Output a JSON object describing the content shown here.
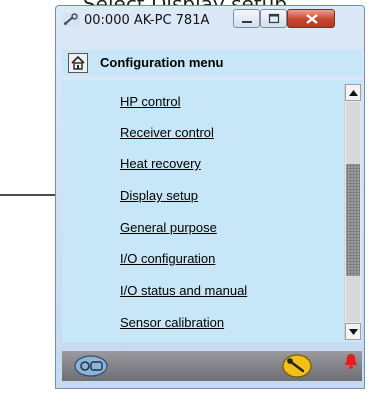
{
  "caption": "Select Display setup",
  "window": {
    "title": "00:000 AK-PC 781A"
  },
  "menu": {
    "title": "Configuration menu",
    "items": [
      {
        "label": "HP control"
      },
      {
        "label": "Receiver control"
      },
      {
        "label": "Heat recovery"
      },
      {
        "label": "Display setup"
      },
      {
        "label": "General purpose"
      },
      {
        "label": "I/O configuration"
      },
      {
        "label": "I/O status and manual"
      },
      {
        "label": "Sensor calibration"
      }
    ]
  },
  "icons": {
    "app": "wrench-app-icon",
    "home": "home-icon",
    "connection": "controller-connection-icon",
    "tool": "wrench-tool-icon",
    "alarm": "alarm-bell-icon"
  },
  "colors": {
    "content_bg": "#c7e6f7",
    "close_button": "#c8452d",
    "alarm": "#e0201e"
  }
}
